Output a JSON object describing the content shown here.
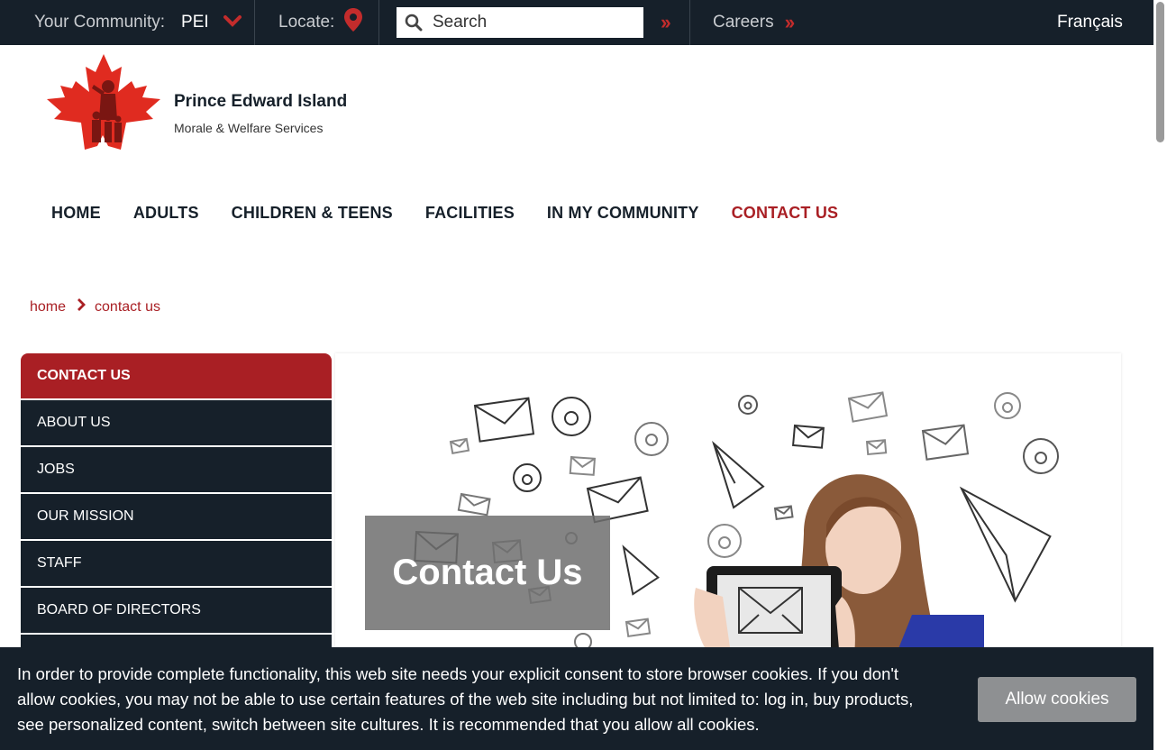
{
  "topbar": {
    "community_label": "Your Community:",
    "community_value": "PEI",
    "locate_label": "Locate:",
    "search_placeholder": "Search",
    "careers_label": "Careers",
    "language_link": "Français"
  },
  "header": {
    "site_title": "Prince Edward Island",
    "site_subtitle": "Morale & Welfare Services"
  },
  "main_nav": {
    "items": [
      "HOME",
      "ADULTS",
      "CHILDREN & TEENS",
      "FACILITIES",
      "IN MY COMMUNITY",
      "CONTACT US"
    ],
    "active": "CONTACT US"
  },
  "breadcrumb": {
    "home": "home",
    "current": "contact us"
  },
  "side_nav": {
    "items": [
      "CONTACT US",
      "ABOUT US",
      "JOBS",
      "OUR MISSION",
      "STAFF",
      "BOARD OF DIRECTORS"
    ]
  },
  "hero": {
    "title": "Contact Us"
  },
  "cookie_banner": {
    "text": "In order to provide complete functionality, this web site needs your explicit consent to store browser cookies. If you don't allow cookies, you may not be able to use certain features of the web site including but not limited to: log in, buy products, see personalized content, switch between site cultures. It is recommended that you allow all cookies.",
    "button_label": "Allow cookies"
  },
  "colors": {
    "dark_navy": "#16202a",
    "brand_red": "#a91f24",
    "accent_red": "#c32c2c",
    "button_gray": "#8e9092"
  },
  "icons": [
    "chevron-down-icon",
    "location-pin-icon",
    "search-icon",
    "double-chevron-right-icon",
    "chevron-right-icon"
  ]
}
